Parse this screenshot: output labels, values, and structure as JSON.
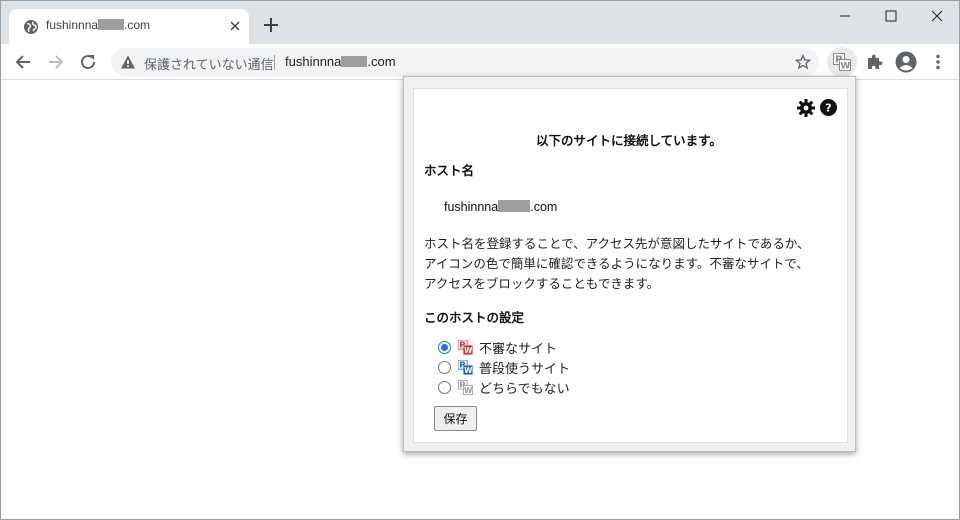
{
  "browser": {
    "tab_title_prefix": "fushinnna",
    "tab_title_suffix": ".com",
    "url_security_label": "保護されていない通信",
    "url_prefix": "fushinnna",
    "url_suffix": ".com"
  },
  "popup": {
    "heading": "以下のサイトに接続しています。",
    "host_label": "ホスト名",
    "host_prefix": "fushinnna",
    "host_suffix": ".com",
    "description_lines": [
      "ホスト名を登録することで、アクセス先が意図したサイトであるか、",
      "アイコンの色で簡単に確認できるようになります。不審なサイトで、",
      "アクセスをブロックすることもできます。"
    ],
    "settings_label": "このホストの設定",
    "options": [
      {
        "label": "不審なサイト",
        "checked": true,
        "icon": "pw-red-icon"
      },
      {
        "label": "普段使うサイト",
        "checked": false,
        "icon": "pw-blue-icon"
      },
      {
        "label": "どちらでもない",
        "checked": false,
        "icon": "pw-gray-icon"
      }
    ],
    "save_label": "保存"
  },
  "colors": {
    "pw_red": "#d32f2f",
    "pw_blue": "#1565c0",
    "pw_gray": "#9e9e9e",
    "radio_checked": "#1a73e8"
  }
}
